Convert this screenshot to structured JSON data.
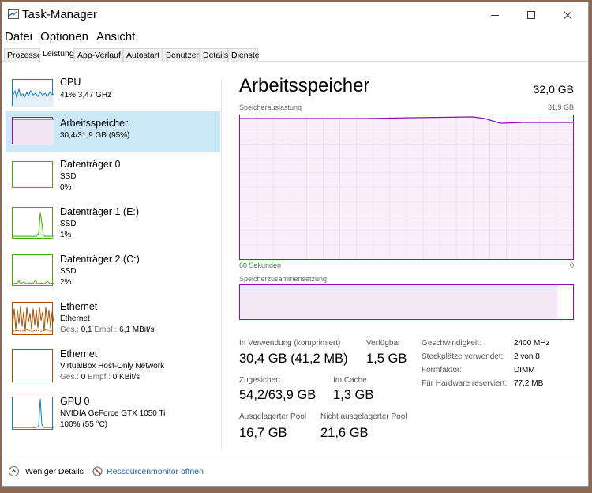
{
  "window": {
    "title": "Task-Manager",
    "buttons": {
      "minimize": "minimize-icon",
      "maximize": "maximize-icon",
      "close": "close-icon"
    }
  },
  "menu": [
    "Datei",
    "Optionen",
    "Ansicht"
  ],
  "tabs": [
    "Prozesse",
    "Leistung",
    "App-Verlauf",
    "Autostart",
    "Benutzer",
    "Details",
    "Dienste"
  ],
  "active_tab": "Leistung",
  "colors": {
    "accent_memory": "#8b12ae",
    "cpu": "#117dbb",
    "disk": "#4da60c",
    "ethernet": "#a74f01",
    "selected_bg": "#cce8f7"
  },
  "sidebar": {
    "items": [
      {
        "title": "CPU",
        "line1": "41% 3,47 GHz"
      },
      {
        "title": "Arbeitsspeicher",
        "line1": "30,4/31,9 GB (95%)"
      },
      {
        "title": "Datenträger 0",
        "line1": "SSD",
        "line2": "0%"
      },
      {
        "title": "Datenträger 1 (E:)",
        "line1": "SSD",
        "line2": "1%"
      },
      {
        "title": "Datenträger 2 (C:)",
        "line1": "SSD",
        "line2": "2%"
      },
      {
        "title": "Ethernet",
        "line1": "Ethernet",
        "ges_label": "Ges.:",
        "ges_val": "0,1",
        "empf_label": "Empf.:",
        "empf_val": "6,1 MBit/s"
      },
      {
        "title": "Ethernet",
        "line1": "VirtualBox Host-Only Network",
        "ges_label": "Ges.:",
        "ges_val": "0",
        "empf_label": "Empf.:",
        "empf_val": "0 KBit/s"
      },
      {
        "title": "GPU 0",
        "line1": "NVIDIA GeForce GTX 1050 Ti",
        "line2": "100%  (55 °C)"
      }
    ],
    "selected_index": 1
  },
  "main": {
    "title": "Arbeitsspeicher",
    "total": "32,0 GB",
    "graph_label": "Speicherauslastung",
    "graph_max": "31,9 GB",
    "graph_time": "60 Sekunden",
    "graph_zero": "0",
    "composition_label": "Speicherzusammensetzung",
    "composition_in_use_fraction": 0.95,
    "stats": {
      "in_use_label": "In Verwendung (komprimiert)",
      "in_use_value": "30,4 GB (41,2 MB)",
      "available_label": "Verfügbar",
      "available_value": "1,5 GB",
      "committed_label": "Zugesichert",
      "committed_value": "54,2/63,9 GB",
      "cached_label": "Im Cache",
      "cached_value": "1,3 GB",
      "paged_pool_label": "Ausgelagerter Pool",
      "paged_pool_value": "16,7 GB",
      "nonpaged_pool_label": "Nicht ausgelagerter Pool",
      "nonpaged_pool_value": "21,6 GB"
    },
    "details": [
      {
        "label": "Geschwindigkeit:",
        "value": "2400 MHz"
      },
      {
        "label": "Steckplätze verwendet:",
        "value": "2 von 8"
      },
      {
        "label": "Formfaktor:",
        "value": "DIMM"
      },
      {
        "label": "Für Hardware reserviert:",
        "value": "77,2 MB"
      }
    ]
  },
  "footer": {
    "less_details": "Weniger Details",
    "resource_monitor": "Ressourcenmonitor öffnen"
  }
}
